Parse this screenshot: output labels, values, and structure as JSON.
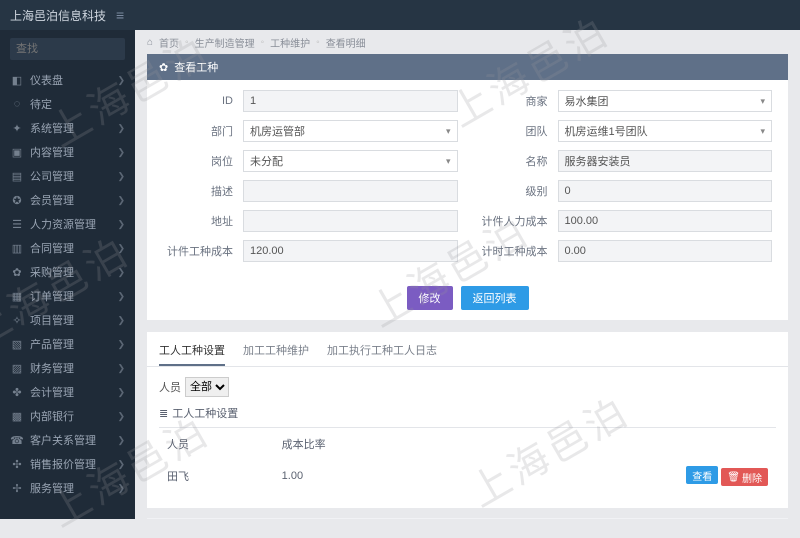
{
  "brand": "上海邑泊信息科技",
  "watermark_text": "上海邑泊",
  "search_placeholder": "查找",
  "nav": [
    {
      "icon": "◧",
      "label": "仪表盘",
      "exp": true
    },
    {
      "icon": "◌",
      "label": "待定",
      "exp": false
    },
    {
      "icon": "✦",
      "label": "系统管理",
      "exp": true
    },
    {
      "icon": "▣",
      "label": "内容管理",
      "exp": true
    },
    {
      "icon": "▤",
      "label": "公司管理",
      "exp": true
    },
    {
      "icon": "✪",
      "label": "会员管理",
      "exp": true
    },
    {
      "icon": "☰",
      "label": "人力资源管理",
      "exp": true
    },
    {
      "icon": "▥",
      "label": "合同管理",
      "exp": true
    },
    {
      "icon": "✿",
      "label": "采购管理",
      "exp": true
    },
    {
      "icon": "▦",
      "label": "订单管理",
      "exp": true
    },
    {
      "icon": "✧",
      "label": "项目管理",
      "exp": true
    },
    {
      "icon": "▧",
      "label": "产品管理",
      "exp": true
    },
    {
      "icon": "▨",
      "label": "财务管理",
      "exp": true
    },
    {
      "icon": "✤",
      "label": "会计管理",
      "exp": true
    },
    {
      "icon": "▩",
      "label": "内部银行",
      "exp": true
    },
    {
      "icon": "☎",
      "label": "客户关系管理",
      "exp": true
    },
    {
      "icon": "✣",
      "label": "销售报价管理",
      "exp": true
    },
    {
      "icon": "✢",
      "label": "服务管理",
      "exp": true
    }
  ],
  "crumbs": {
    "home_icon": "⌂",
    "home": "首页",
    "l1": "生产制造管理",
    "l2": "工种维护",
    "l3": "查看明细"
  },
  "panel_title": "查看工种",
  "fields": {
    "id_label": "ID",
    "id_value": "1",
    "merchant_label": "商家",
    "merchant_value": "易水集团",
    "dept_label": "部门",
    "dept_value": "机房运管部",
    "team_label": "团队",
    "team_value": "机房运维1号团队",
    "post_label": "岗位",
    "post_value": "未分配",
    "name_label": "名称",
    "name_value": "服务器安装员",
    "desc_label": "描述",
    "desc_value": "",
    "level_label": "级别",
    "level_value": "0",
    "addr_label": "地址",
    "addr_value": "",
    "piece_labor_label": "计件人力成本",
    "piece_labor_value": "100.00",
    "piece_type_label": "计件工种成本",
    "piece_type_value": "120.00",
    "time_type_label": "计时工种成本",
    "time_type_value": "0.00"
  },
  "buttons": {
    "modify": "修改",
    "back": "返回列表",
    "view": "查看",
    "delete": "删除"
  },
  "tabs": {
    "t1": "工人工种设置",
    "t2": "加工工种维护",
    "t3": "加工执行工种工人日志"
  },
  "filter": {
    "label": "人员",
    "value": "全部"
  },
  "sub_title": "工人工种设置",
  "table": {
    "c1": "人员",
    "c2": "成本比率",
    "r1c1": "田飞",
    "r1c2": "1.00"
  },
  "delete_prefix": "删除"
}
